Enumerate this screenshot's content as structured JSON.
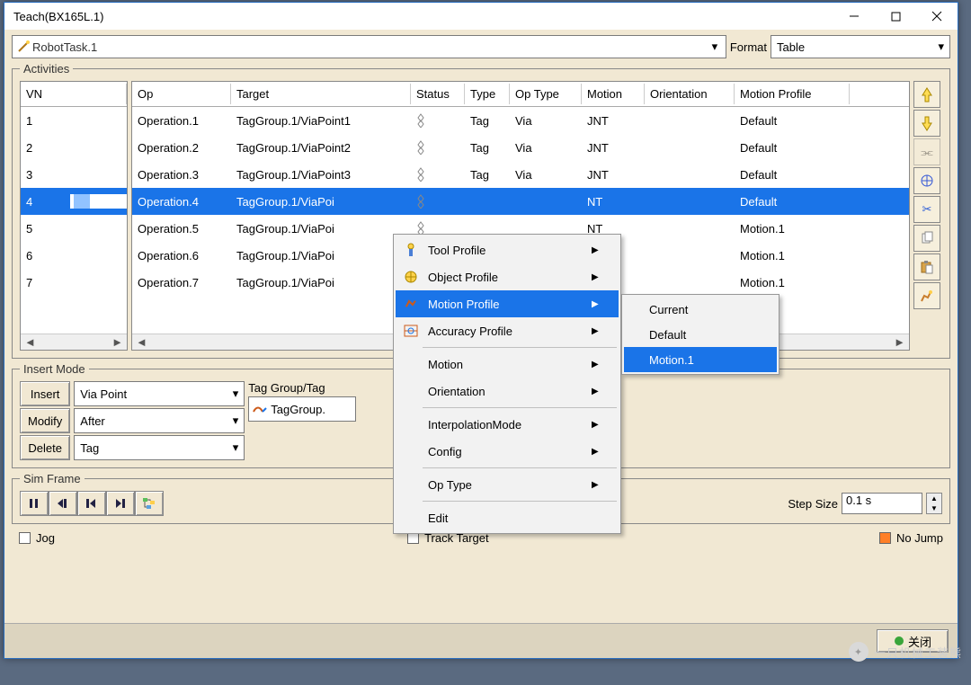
{
  "window": {
    "title": "Teach(BX165L.1)"
  },
  "top": {
    "task": "RobotTask.1",
    "format_label": "Format",
    "format_value": "Table"
  },
  "activities": {
    "legend": "Activities",
    "vn_header": "VN",
    "headers": {
      "op": "Op",
      "target": "Target",
      "status": "Status",
      "type": "Type",
      "optype": "Op Type",
      "motion": "Motion",
      "orient": "Orientation",
      "mprof": "Motion Profile"
    },
    "rows": [
      {
        "vn": "1",
        "op": "Operation.1",
        "target": "TagGroup.1/ViaPoint1",
        "type": "Tag",
        "optype": "Via",
        "motion": "JNT",
        "mprof": "Default"
      },
      {
        "vn": "2",
        "op": "Operation.2",
        "target": "TagGroup.1/ViaPoint2",
        "type": "Tag",
        "optype": "Via",
        "motion": "JNT",
        "mprof": "Default"
      },
      {
        "vn": "3",
        "op": "Operation.3",
        "target": "TagGroup.1/ViaPoint3",
        "type": "Tag",
        "optype": "Via",
        "motion": "JNT",
        "mprof": "Default"
      },
      {
        "vn": "4",
        "op": "Operation.4",
        "target": "TagGroup.1/ViaPoi",
        "type": "",
        "optype": "",
        "motion": "NT",
        "mprof": "Default",
        "selected": true
      },
      {
        "vn": "5",
        "op": "Operation.5",
        "target": "TagGroup.1/ViaPoi",
        "type": "",
        "optype": "",
        "motion": "NT",
        "mprof": "Motion.1"
      },
      {
        "vn": "6",
        "op": "Operation.6",
        "target": "TagGroup.1/ViaPoi",
        "type": "",
        "optype": "",
        "motion": "NT",
        "mprof": "Motion.1"
      },
      {
        "vn": "7",
        "op": "Operation.7",
        "target": "TagGroup.1/ViaPoi",
        "type": "",
        "optype": "",
        "motion": "NT",
        "mprof": "Motion.1"
      }
    ]
  },
  "context_menu": {
    "items": [
      {
        "label": "Tool Profile",
        "icon": "tool",
        "arrow": true
      },
      {
        "label": "Object Profile",
        "icon": "object",
        "arrow": true
      },
      {
        "label": "Motion Profile",
        "icon": "motion",
        "arrow": true,
        "highlight": true
      },
      {
        "label": "Accuracy Profile",
        "icon": "accuracy",
        "arrow": true
      },
      {
        "sep": true
      },
      {
        "label": "Motion",
        "arrow": true
      },
      {
        "label": "Orientation",
        "arrow": true
      },
      {
        "sep": true
      },
      {
        "label": "InterpolationMode",
        "arrow": true
      },
      {
        "label": "Config",
        "arrow": true
      },
      {
        "sep": true
      },
      {
        "label": "Op Type",
        "arrow": true
      },
      {
        "sep": true
      },
      {
        "label": "Edit"
      }
    ],
    "submenu": [
      {
        "label": "Current"
      },
      {
        "label": "Default"
      },
      {
        "label": "Motion.1",
        "highlight": true
      }
    ]
  },
  "insert": {
    "legend": "Insert Mode",
    "btn_insert": "Insert",
    "btn_modify": "Modify",
    "btn_delete": "Delete",
    "sel1": "Via Point",
    "sel2": "After",
    "sel3": "Tag",
    "tag_label": "Tag Group/Tag",
    "tag_value": "TagGroup."
  },
  "sim": {
    "legend": "Sim Frame",
    "step_label": "Step Size",
    "step_value": "0.1 s"
  },
  "bottom": {
    "jog": "Jog",
    "track": "Track Target",
    "nojump": "No Jump"
  },
  "footer": {
    "close": "关闭"
  },
  "watermark": "一只机械工装熊"
}
